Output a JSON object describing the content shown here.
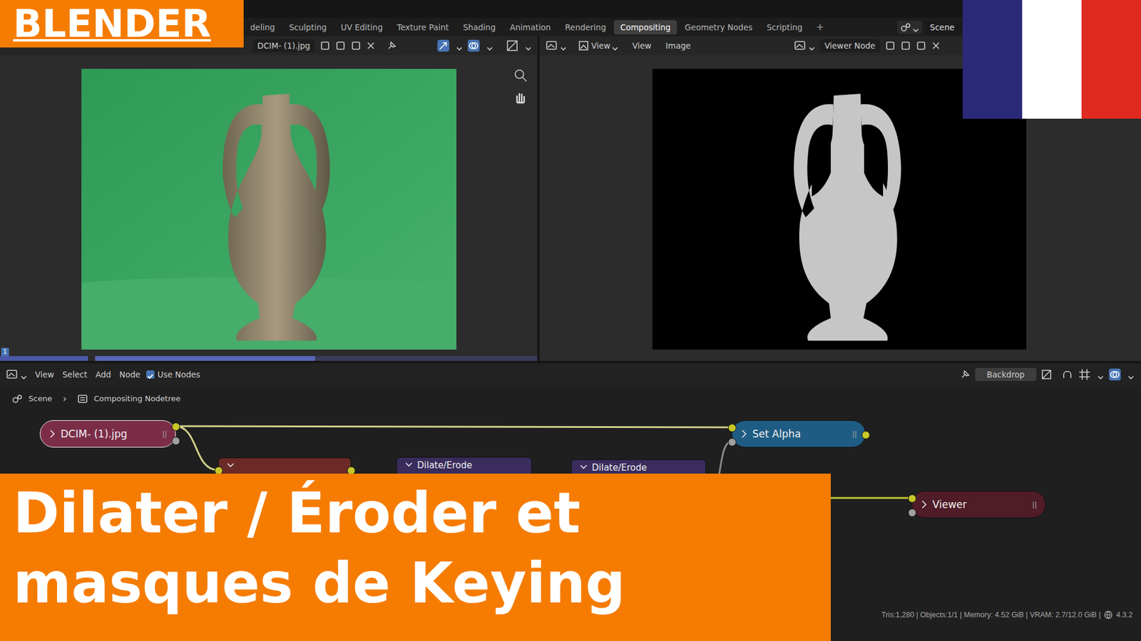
{
  "badge": {
    "text": "BLENDER"
  },
  "topbar": {
    "tabs": [
      {
        "label": "deling",
        "selected": false
      },
      {
        "label": "Sculpting",
        "selected": false
      },
      {
        "label": "UV Editing",
        "selected": false
      },
      {
        "label": "Texture Paint",
        "selected": false
      },
      {
        "label": "Shading",
        "selected": false
      },
      {
        "label": "Animation",
        "selected": false
      },
      {
        "label": "Rendering",
        "selected": false
      },
      {
        "label": "Compositing",
        "selected": true
      },
      {
        "label": "Geometry Nodes",
        "selected": false
      },
      {
        "label": "Scripting",
        "selected": false
      }
    ],
    "add": "+",
    "scene": "Scene"
  },
  "image_editor": {
    "image_name": "DCIM- (1).jpg",
    "frame": "1"
  },
  "viewer_editor": {
    "menus": [
      "View",
      "View",
      "Image"
    ],
    "image_name": "Viewer Node"
  },
  "node_editor": {
    "menus": [
      "View",
      "Select",
      "Add",
      "Node"
    ],
    "use_nodes": {
      "label": "Use Nodes",
      "checked": true
    },
    "backdrop": "Backdrop",
    "breadcrumb": [
      "Scene",
      "Compositing Nodetree"
    ],
    "breadcrumb_separator": "›"
  },
  "nodes": [
    {
      "title": "DCIM- (1).jpg",
      "expanded": false,
      "selected": true,
      "color": "#7b2d48"
    },
    {
      "title": "Set Alpha",
      "expanded": false,
      "selected": false,
      "color": "#1f5c84"
    },
    {
      "title": "Viewer",
      "expanded": false,
      "selected": false,
      "color": "#4f1c28"
    },
    {
      "expanded": true,
      "selected": false,
      "color": "#6b2a26"
    },
    {
      "title": "Dilate/Erode",
      "expanded": true,
      "selected": false,
      "color": "#3a2c5c"
    },
    {
      "title": "Dilate/Erode",
      "expanded": true,
      "selected": false,
      "color": "#3a2c5c"
    }
  ],
  "title_banner": {
    "lines": [
      "Dilater / Éroder et",
      "masques de Keying"
    ]
  },
  "status_bar": {
    "text": "Tris:1,280 | Objects:1/1 | Memory: 4.52 GiB | VRAM: 2.7/12.0 GiB |",
    "version": "4.3.2"
  }
}
